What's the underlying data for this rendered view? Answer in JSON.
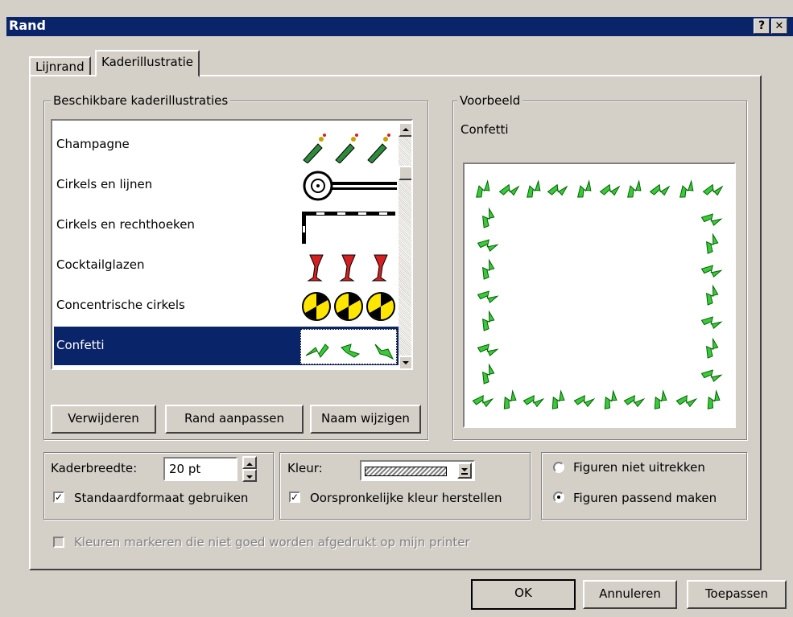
{
  "window": {
    "title": "Rand",
    "help_label": "?",
    "close_label": "✕"
  },
  "tabs": [
    {
      "label": "Lijnrand",
      "active": false
    },
    {
      "label": "Kaderillustratie",
      "active": true
    }
  ],
  "available": {
    "legend": "Beschikbare kaderillustraties",
    "items": [
      {
        "label": "Champagne",
        "icon": "champagne-bottle-icon"
      },
      {
        "label": "Cirkels en lijnen",
        "icon": "circles-lines-icon"
      },
      {
        "label": "Cirkels en rechthoeken",
        "icon": "circles-rectangles-icon"
      },
      {
        "label": "Cocktailglazen",
        "icon": "cocktail-glass-icon"
      },
      {
        "label": "Concentrische cirkels",
        "icon": "concentric-circles-icon"
      },
      {
        "label": "Confetti",
        "icon": "confetti-icon",
        "selected": true
      }
    ],
    "buttons": {
      "delete": "Verwijderen",
      "customize": "Rand aanpassen",
      "rename": "Naam wijzigen"
    }
  },
  "preview": {
    "legend": "Voorbeeld",
    "name": "Confetti"
  },
  "width": {
    "label": "Kaderbreedte:",
    "value": "20 pt",
    "default_checkbox": "Standaardformaat gebruiken",
    "default_checked": true
  },
  "color": {
    "label": "Kleur:",
    "restore_checkbox": "Oorspronkelijke kleur herstellen",
    "restore_checked": true
  },
  "shapes": {
    "option1": "Figuren niet uitrekken",
    "option2": "Figuren passend maken",
    "selected": "Figuren passend maken"
  },
  "mark_colors": {
    "label": "Kleuren markeren die niet goed worden afgedrukt op mijn printer",
    "checked": false,
    "enabled": false
  },
  "footer": {
    "ok": "OK",
    "cancel": "Annuleren",
    "apply": "Toepassen"
  },
  "colors": {
    "title_bar": "#0a246a",
    "face": "#d4d0c8",
    "selection": "#0a246a",
    "confetti": "#3cc83c"
  }
}
